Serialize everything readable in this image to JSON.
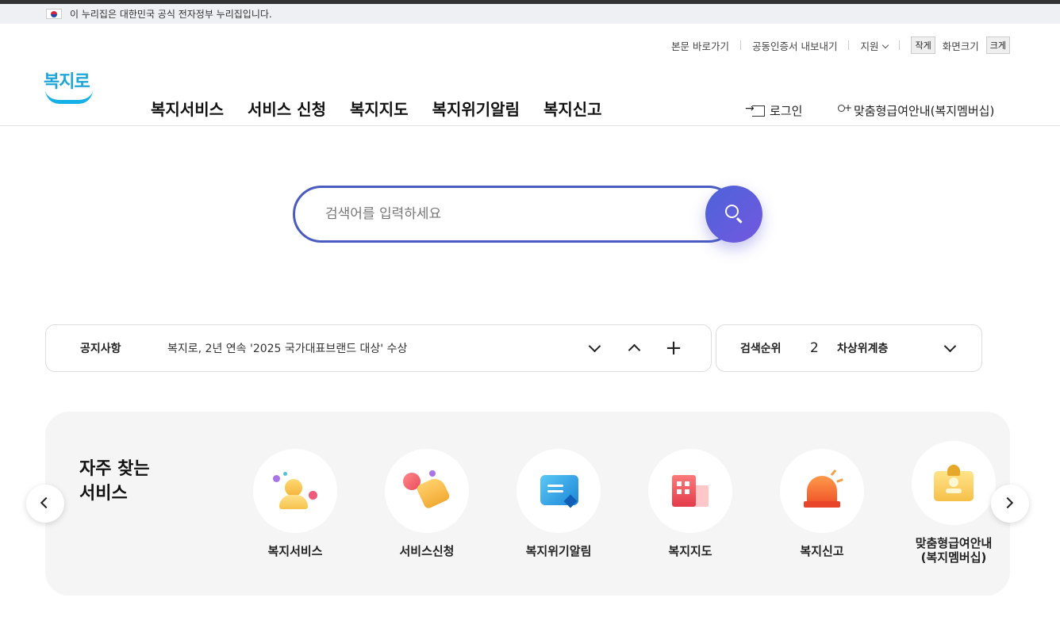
{
  "gov_banner": {
    "text": "이 누리집은 대한민국 공식 전자정부 누리집입니다."
  },
  "util": {
    "skip_link": "본문 바로가기",
    "cert_export": "공동인증서 내보내기",
    "support": "지원",
    "zoom_small": "작게",
    "zoom_label": "화면크기",
    "zoom_large": "크게"
  },
  "logo": {
    "text": "복지로"
  },
  "nav": {
    "items": [
      {
        "label": "복지서비스"
      },
      {
        "label": "서비스 신청"
      },
      {
        "label": "복지지도"
      },
      {
        "label": "복지위기알림"
      },
      {
        "label": "복지신고"
      }
    ]
  },
  "account": {
    "login": "로그인",
    "membership": "맞춤형급여안내(복지멤버십)"
  },
  "search": {
    "placeholder": "검색어를 입력하세요"
  },
  "notice": {
    "label": "공지사항",
    "text": "복지로, 2년 연속 '2025 국가대표브랜드 대상' 수상",
    "more": "+"
  },
  "ranking": {
    "label": "검색순위",
    "rank": "2",
    "keyword": "차상위계층"
  },
  "frequent": {
    "title_line1": "자주 찾는",
    "title_line2": "서비스",
    "items": [
      {
        "label": "복지서비스",
        "icon": "welfare-service-icon"
      },
      {
        "label": "서비스신청",
        "icon": "service-apply-icon"
      },
      {
        "label": "복지위기알림",
        "icon": "crisis-alert-icon"
      },
      {
        "label": "복지지도",
        "icon": "welfare-map-icon"
      },
      {
        "label": "복지신고",
        "icon": "siren-icon"
      },
      {
        "label": "맞춤형급여안내\n(복지멤버십)",
        "icon": "membership-badge-icon"
      }
    ]
  }
}
